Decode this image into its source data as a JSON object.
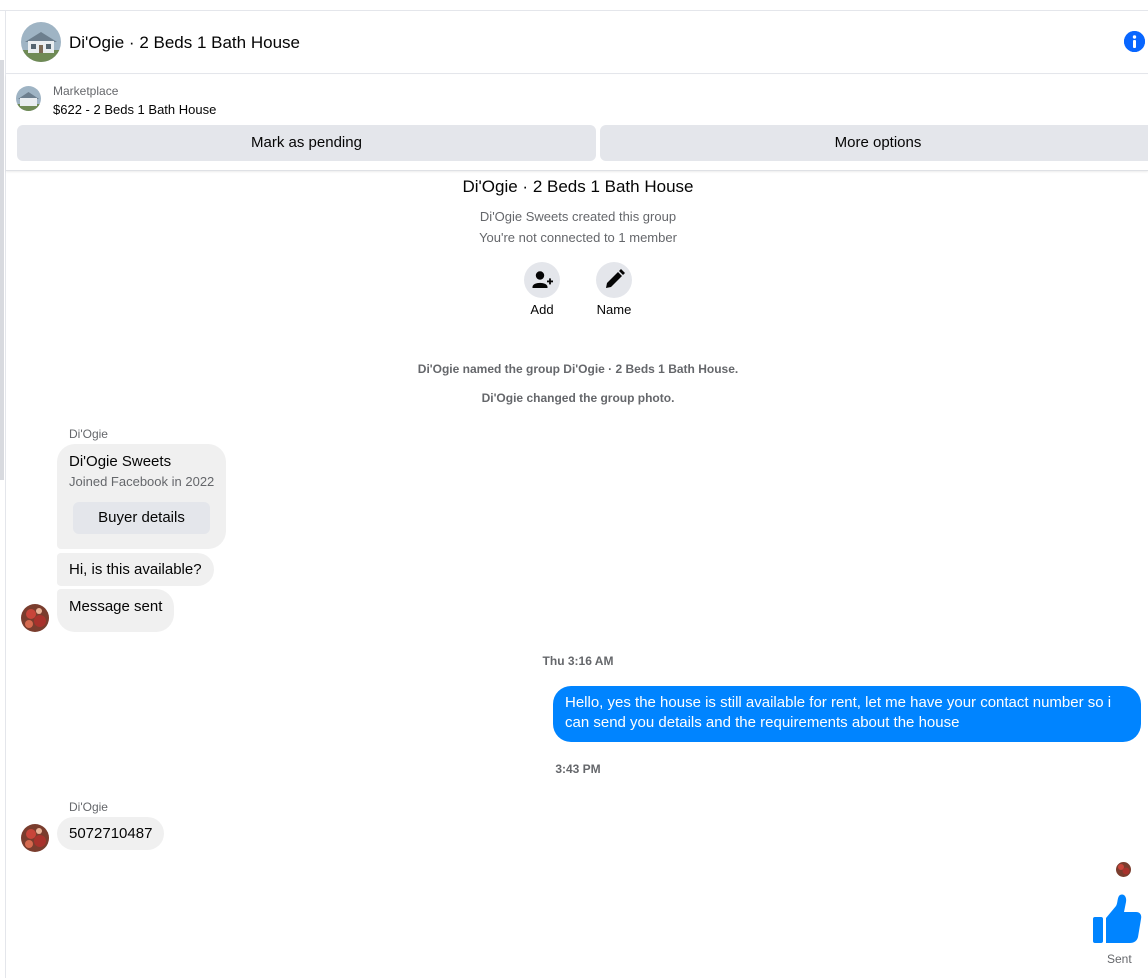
{
  "header": {
    "title": "Di'Ogie · 2 Beds 1 Bath House",
    "info_icon": "info-icon"
  },
  "listing": {
    "source": "Marketplace",
    "item": "$622 - 2 Beds 1 Bath House",
    "mark_pending_label": "Mark as pending",
    "more_options_label": "More options"
  },
  "group": {
    "title": "Di'Ogie · 2 Beds 1 Bath House",
    "created_by": "Di'Ogie Sweets created this group",
    "connection": "You're not connected to 1 member",
    "add_label": "Add",
    "name_label": "Name",
    "notes": [
      "Di'Ogie named the group Di'Ogie · 2 Beds 1 Bath House.",
      "Di'Ogie changed the group photo."
    ]
  },
  "messages": {
    "sender1": "Di'Ogie",
    "buyer_card": {
      "name": "Di'Ogie Sweets",
      "joined": "Joined Facebook in 2022",
      "button": "Buyer details"
    },
    "msg1": "Hi, is this available?",
    "msg2": "Message sent",
    "time1": "Thu 3:16 AM",
    "reply": "Hello, yes the house is still available for rent, let me have your contact number so i can send you details and the requirements about the house",
    "time2": "3:43 PM",
    "sender2": "Di'Ogie",
    "msg3": "5072710487",
    "like_icon": "thumbs-up-icon",
    "status": "Sent"
  },
  "colors": {
    "accent": "#0084ff",
    "bubble_in": "#f0f0f0",
    "button_bg": "#e4e6eb",
    "secondary_text": "#65676b"
  }
}
